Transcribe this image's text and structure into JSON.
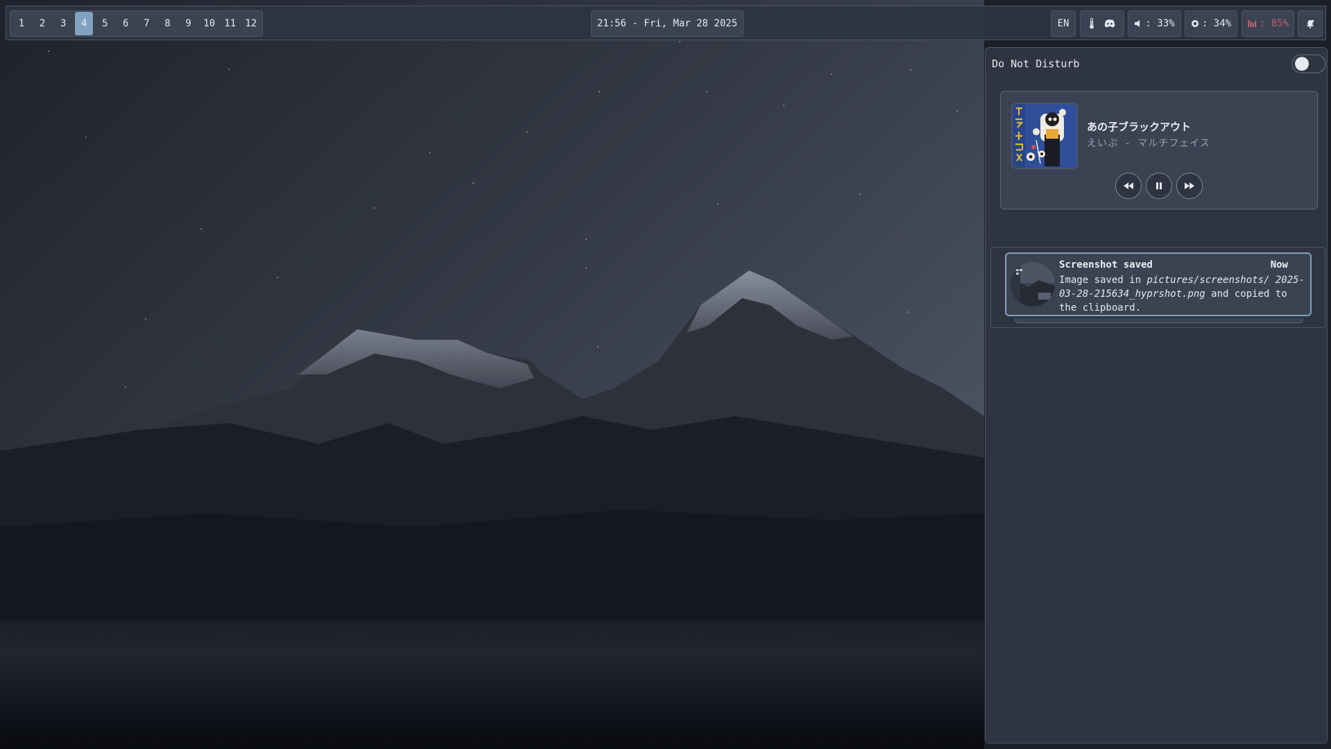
{
  "topbar": {
    "workspaces": [
      {
        "label": "1",
        "active": false
      },
      {
        "label": "2",
        "active": false
      },
      {
        "label": "3",
        "active": false
      },
      {
        "label": "4",
        "active": true
      },
      {
        "label": "5",
        "active": false
      },
      {
        "label": "6",
        "active": false
      },
      {
        "label": "7",
        "active": false
      },
      {
        "label": "8",
        "active": false
      },
      {
        "label": "9",
        "active": false
      },
      {
        "label": "10",
        "active": false
      },
      {
        "label": "11",
        "active": false
      },
      {
        "label": "12",
        "active": false
      }
    ],
    "clock": "21:56 - Fri, Mar 28 2025",
    "language": "EN",
    "tray_icons": [
      "thermometer-icon",
      "discord-icon"
    ],
    "volume": {
      "icon": "speaker-icon",
      "label": ": 33%"
    },
    "brightness": {
      "icon": "sun-icon",
      "label": ": 34%"
    },
    "battery": {
      "icon": "battery-icon",
      "label": ": 85%",
      "color": "#bf616a"
    },
    "notifications_icon": "bell-icon"
  },
  "notification_center": {
    "dnd_label": "Do Not Disturb",
    "dnd_enabled": false,
    "player": {
      "title": "あの子ブラックアウト",
      "artist": "えいぷ - マルチフェイス",
      "controls": [
        "rewind-icon",
        "pause-icon",
        "fast-forward-icon"
      ]
    },
    "notification": {
      "title": "Screenshot saved",
      "time": "Now",
      "body_prefix": "Image saved in ",
      "body_path": "pictures/screenshots/ 2025-03-28-215634_hyprshot.png",
      "body_suffix": " and copied to the clipboard."
    }
  },
  "colors": {
    "bar_bg": "#2e3440",
    "chip_bg": "#3b4252",
    "accent": "#81a1c1",
    "battery_warning": "#bf616a",
    "text": "#e5e9f0"
  }
}
